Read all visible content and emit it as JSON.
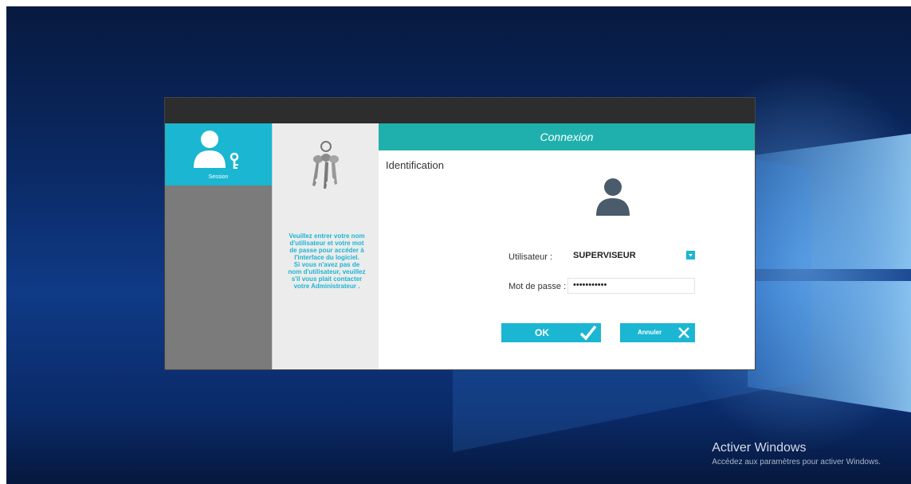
{
  "colors": {
    "accent": "#1bb6d2",
    "header_teal": "#1fb0ad",
    "titlebar": "#2d2d2d",
    "nav_bg": "#7b7b7b",
    "info_bg": "#ececec"
  },
  "sidebar": {
    "items": [
      {
        "label": "Session",
        "icon": "user-key-icon",
        "active": true
      }
    ]
  },
  "info_panel": {
    "icon": "keys-icon",
    "text": "Veuillez entrer votre nom\nd'utilisateur et votre mot\nde passe pour accéder à\nl'interface du logiciel.\nSi vous n'avez pas de\nnom d'utilisateur, veuillez\ns'il vous plait contacter\nvotre Administrateur ."
  },
  "login": {
    "header": "Connexion",
    "section_title": "Identification",
    "avatar_icon": "user-avatar-icon",
    "user_label": "Utilisateur :",
    "user_value": "SUPERVISEUR",
    "password_label": "Mot de passe :",
    "password_value": "•••••••••••",
    "ok_label": "OK",
    "cancel_label": "Annuler"
  },
  "watermark": {
    "title": "Activer Windows",
    "subtitle": "Accédez aux paramètres pour activer Windows."
  }
}
